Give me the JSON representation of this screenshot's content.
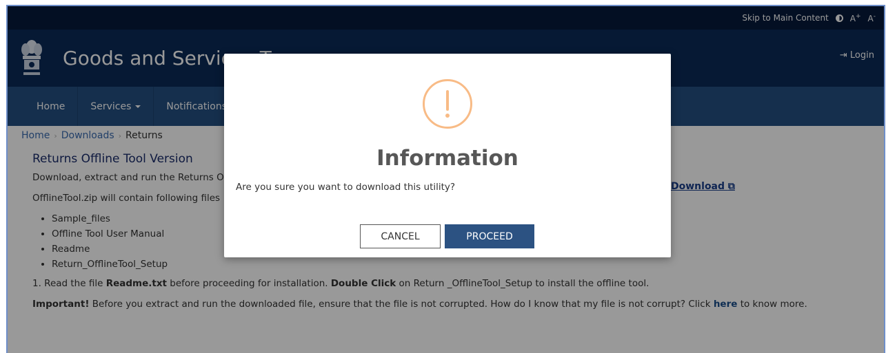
{
  "topbar": {
    "skip_label": "Skip to Main Content",
    "contrast_icon": "contrast-icon",
    "font_increase_label": "A",
    "font_increase_sup": "+",
    "font_decrease_label": "A",
    "font_decrease_sup": "-"
  },
  "header": {
    "title": "Goods and Services Tax",
    "login_label": "Login",
    "emblem_icon": "national-emblem-icon"
  },
  "nav": {
    "items": [
      {
        "label": "Home"
      },
      {
        "label": "Services"
      },
      {
        "label": "Notifications & Circulars"
      }
    ]
  },
  "breadcrumb": {
    "items": [
      {
        "label": "Home"
      },
      {
        "label": "Downloads"
      },
      {
        "label": "Returns"
      }
    ]
  },
  "content": {
    "heading": "Returns Offline Tool Version",
    "intro": "Download, extract and run the Returns Offline Tool",
    "download_label": "Download",
    "zip_text": "OfflineTool.zip will contain following files",
    "files": [
      "Sample_files",
      "Offline Tool User Manual",
      "Readme",
      "Return_OfflineTool_Setup"
    ],
    "step1_prefix": "1. Read the file ",
    "step1_bold1": "Readme.txt",
    "step1_middle": " before proceeding for installation. ",
    "step1_bold2": "Double Click",
    "step1_suffix": " on Return _OfflineTool_Setup to install the offline tool.",
    "important_label": "Important!",
    "important_text": " Before you extract and run the downloaded file, ensure that the file is not corrupted. How do I know that my file is not corrupt? Click ",
    "here_label": "here",
    "important_suffix": " to know more."
  },
  "modal": {
    "title": "Information",
    "message": "Are you sure you want to download this utility?",
    "cancel_label": "CANCEL",
    "proceed_label": "PROCEED",
    "icon": "warning-icon",
    "colors": {
      "icon": "#f8bb86",
      "proceed_bg": "#2c5282"
    }
  }
}
